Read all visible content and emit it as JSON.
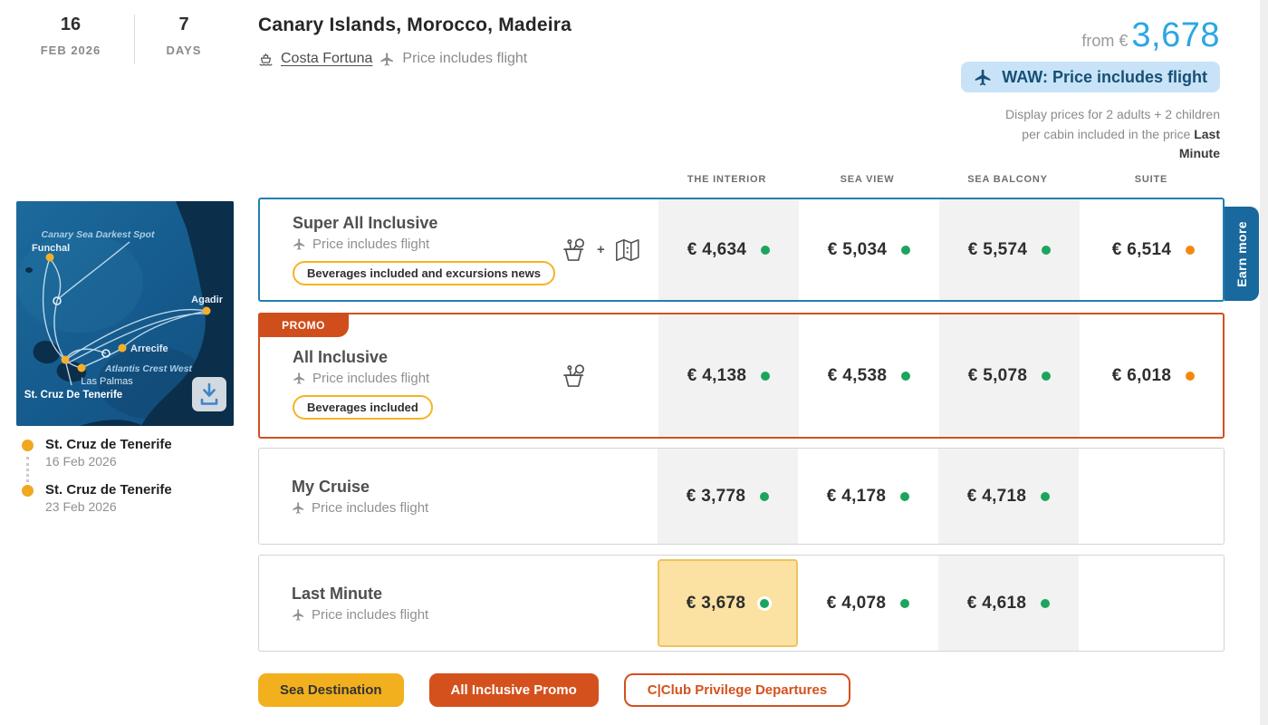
{
  "header": {
    "day": "16",
    "month": "FEB 2026",
    "duration": "7",
    "duration_label": "DAYS",
    "title": "Canary Islands, Morocco, Madeira",
    "ship": "Costa Fortuna",
    "flight_note": "Price includes flight",
    "from_label": "from €",
    "from_price": "3,678",
    "waw_badge": "WAW: Price includes flight",
    "note": "Display prices for 2 adults + 2 children per cabin included in the price",
    "note_bold": "Last Minute"
  },
  "map": {
    "region_label": "Canary Sea Darkest Spot",
    "spot_label": "Atlantis Crest West",
    "ports": [
      "Funchal",
      "Agadir",
      "Arrecife",
      "Las Palmas",
      "St. Cruz De Tenerife"
    ],
    "icons": {
      "download": "download-icon"
    }
  },
  "itinerary": [
    {
      "port": "St. Cruz de Tenerife",
      "date": "16 Feb 2026"
    },
    {
      "port": "St. Cruz de Tenerife",
      "date": "23 Feb 2026"
    }
  ],
  "table": {
    "columns": [
      "THE INTERIOR",
      "SEA VIEW",
      "SEA BALCONY",
      "SUITE"
    ],
    "rows": [
      {
        "name": "Super All Inclusive",
        "flight_note": "Price includes flight",
        "pill": "Beverages included and excursions news",
        "icons": [
          "beverage-icon",
          "plus",
          "map-icon"
        ],
        "plus": "+",
        "prices": [
          {
            "value": "€ 4,634",
            "status": "green"
          },
          {
            "value": "€ 5,034",
            "status": "green"
          },
          {
            "value": "€ 5,574",
            "status": "green"
          },
          {
            "value": "€ 6,514",
            "status": "orange"
          }
        ]
      },
      {
        "name": "All Inclusive",
        "promo": "PROMO",
        "flight_note": "Price includes flight",
        "pill": "Beverages included",
        "icons": [
          "beverage-icon"
        ],
        "prices": [
          {
            "value": "€ 4,138",
            "status": "green"
          },
          {
            "value": "€ 4,538",
            "status": "green"
          },
          {
            "value": "€ 5,078",
            "status": "green"
          },
          {
            "value": "€ 6,018",
            "status": "orange"
          }
        ]
      },
      {
        "name": "My Cruise",
        "flight_note": "Price includes flight",
        "prices": [
          {
            "value": "€ 3,778",
            "status": "green"
          },
          {
            "value": "€ 4,178",
            "status": "green"
          },
          {
            "value": "€ 4,718",
            "status": "green"
          },
          null
        ]
      },
      {
        "name": "Last Minute",
        "flight_note": "Price includes flight",
        "prices": [
          {
            "value": "€ 3,678",
            "status": "green",
            "highlight": true
          },
          {
            "value": "€ 4,078",
            "status": "green"
          },
          {
            "value": "€ 4,618",
            "status": "green"
          },
          null
        ]
      }
    ]
  },
  "earn_more": "Earn more",
  "footer_buttons": [
    {
      "label": "Sea Destination",
      "style": "yellow"
    },
    {
      "label": "All Inclusive Promo",
      "style": "orange"
    },
    {
      "label": "C|Club Privilege Departures",
      "style": "outline"
    }
  ],
  "colors": {
    "accent_blue": "#2aa7e3",
    "waw_bg": "#c8e3f7",
    "waw_text": "#174f75",
    "promo_orange": "#cf4e1b",
    "row1_border": "#2180ae",
    "pill_yellow": "#f5b325",
    "dot_green": "#1ca45c",
    "dot_orange": "#f6880f",
    "highlight_bg": "#fbe2a2",
    "highlight_border": "#eec35e",
    "earn_more_bg": "#19699e",
    "button_yellow": "#f2b01e",
    "button_orange": "#d4511d"
  }
}
